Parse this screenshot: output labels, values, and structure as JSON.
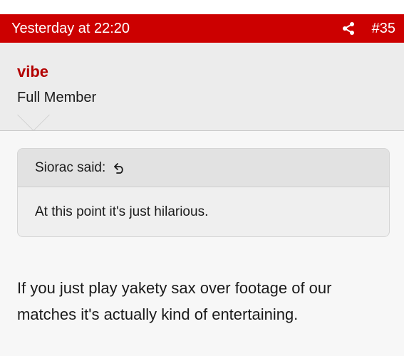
{
  "post": {
    "time": "Yesterday at 22:20",
    "number": "#35",
    "share_icon": "share-icon",
    "header_color": "#cc0000"
  },
  "user": {
    "name": "vibe",
    "title": "Full Member",
    "name_color": "#b30000"
  },
  "quote": {
    "author": "Siorac said:",
    "jump_icon": "go-to-quote-icon",
    "text": "At this point it's just hilarious."
  },
  "message": {
    "text": "If you just play yakety sax over footage of our matches it's actually kind of entertaining."
  }
}
